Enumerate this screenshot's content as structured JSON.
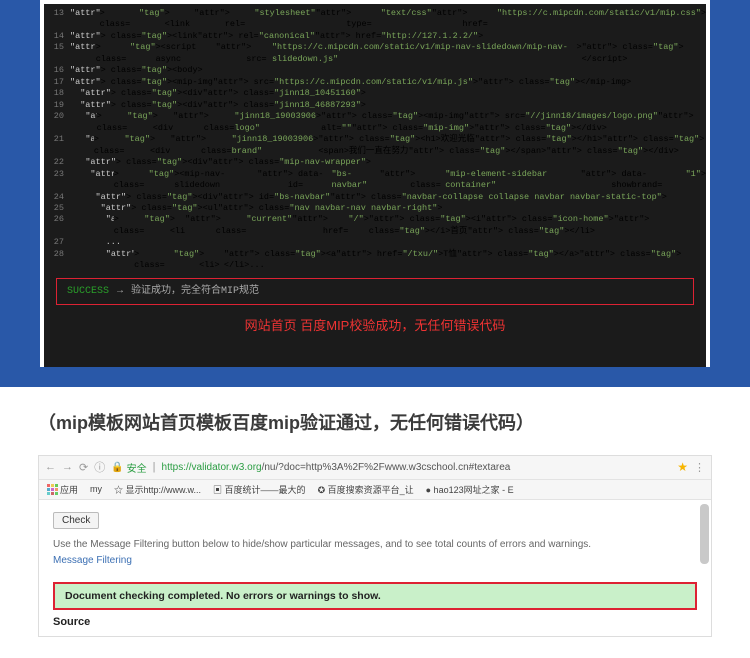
{
  "editor": {
    "line_start": 13,
    "lines": [
      "<link rel=\"stylesheet\" type=\"text/css\" href=\"https://c.mipcdn.com/static/v1/mip.css\">",
      "<link rel=\"canonical\" href=\"http://127.1.2.2/\">",
      "<script async src=\"https://c.mipcdn.com/static/v1/mip-nav-slidedown/mip-nav-slidedown.js\"></script>",
      "<body>",
      "<mip-img src=\"https://c.mipcdn.com/static/v1/mip.js\"></mip-img>",
      "  <div class=\"jinn18_10451160\">",
      "  <div class=\"jinn18_46887293\">",
      "   <div class=\"jinn18_19003906 logo\"><mip-img src=\"//jinn18/images/logo.png\" alt=\"\" class=\"mip-img\"></div>",
      "   <div class=\"jinn18_19003906 brand\"><h1>欢迎光临</h1><span>我们一直在努力</span></div>",
      "   <div class=\"mip-nav-wrapper\">",
      "    <mip-nav-slidedown data-id=\"bs-navbar\" class=\"mip-element-sidebar container\" data-showbrand=\"1\">",
      "     <div id=\"bs-navbar\" class=\"navbar-collapse collapse navbar navbar-static-top\">",
      "      <ul class=\"nav navbar-nav navbar-right\">",
      "       <li class=\"current\" href=\"/\"><i class=\"icon-home\"></i>首页</li>",
      "       ...",
      "       <li><a href=\"/txu/\">T恤</a></li>..."
    ],
    "status_word": "SUCCESS",
    "status_arrow": "→",
    "status_text": "验证成功，完全符合MIP规范",
    "red_note": "网站首页 百度MIP校验成功，无任何错误代码"
  },
  "caption": "（mip模板网站首页模板百度mip验证通过，无任何错误代码）",
  "browser": {
    "secure_label": "安全",
    "url_host": "https://validator.w3.org",
    "url_path": "/nu/?doc=http%3A%2F%2Fwww.w3cschool.cn#textarea",
    "apps_label": "应用",
    "bookmarks": [
      "my",
      "☆ 显示http://www.w...",
      "▣ 百度统计——最大的",
      "✪ 百度搜索资源平台_让",
      "● hao123网址之家 - E"
    ]
  },
  "page": {
    "check_btn": "Check",
    "instruction": "Use the Message Filtering button below to hide/show particular messages, and to see total counts of errors and warnings.",
    "filter_link": "Message Filtering",
    "result": "Document checking completed. No errors or warnings to show.",
    "source_label": "Source"
  }
}
